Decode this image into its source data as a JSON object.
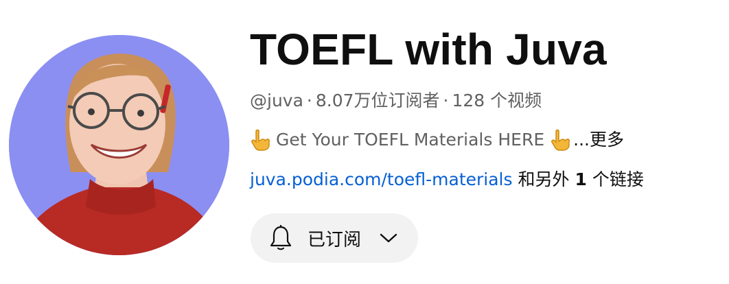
{
  "channel": {
    "name": "TOEFL with Juva",
    "handle": "@juva",
    "separator": "·",
    "subscribers": "8.07万位订阅者",
    "videos": "128 个视频"
  },
  "description": {
    "leading_emoji": "pointing-down-hand-icon",
    "text": "Get Your TOEFL Materials HERE",
    "trailing_emoji": "pointing-down-hand-icon",
    "more": "...更多"
  },
  "links": {
    "primary": "juva.podia.com/toefl-materials",
    "extra_prefix": "和另外",
    "extra_count": "1",
    "extra_suffix": "个链接"
  },
  "subscribe_button": {
    "icon": "bell-icon",
    "label": "已订阅",
    "dropdown_icon": "chevron-down-icon"
  },
  "colors": {
    "avatar_background": "#8b8ff2",
    "link": "#065fd4",
    "secondary_text": "#606060",
    "button_background": "#f2f2f2"
  }
}
